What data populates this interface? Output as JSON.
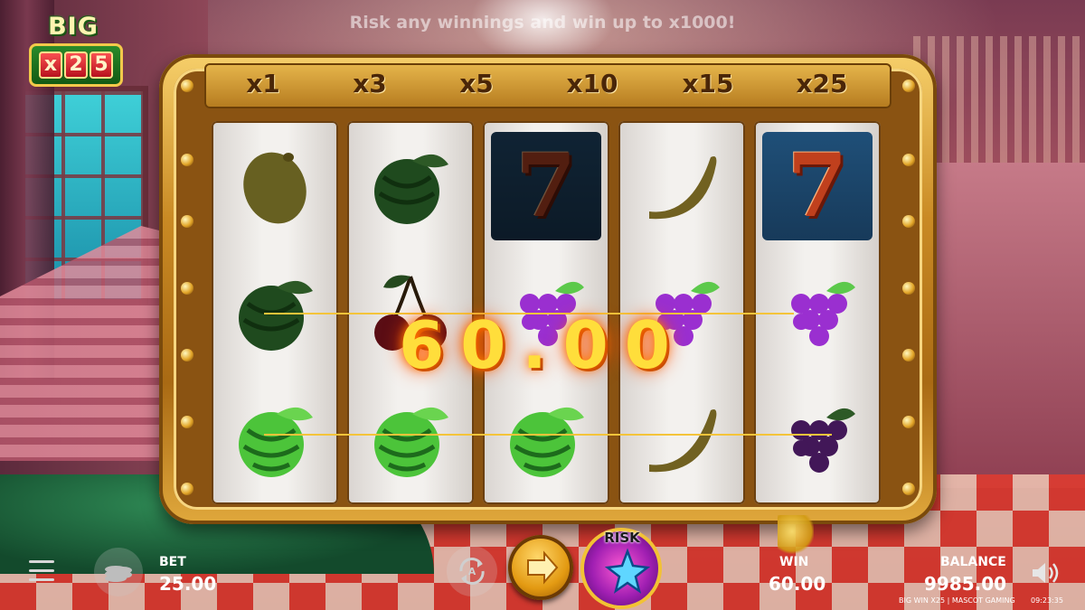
{
  "promo_text": "Risk any winnings and win up to x1000!",
  "logo": {
    "line1": "BIG WIN",
    "digits": [
      "x",
      "2",
      "5"
    ]
  },
  "multipliers": [
    "x1",
    "x3",
    "x5",
    "x10",
    "x15",
    "x25"
  ],
  "reels": [
    [
      "lemon",
      "watermelon",
      "watermelon"
    ],
    [
      "watermelon",
      "cherry",
      "watermelon"
    ],
    [
      "seven",
      "grapes",
      "watermelon"
    ],
    [
      "banana",
      "grapes",
      "banana"
    ],
    [
      "seven",
      "grapes",
      "grapes"
    ]
  ],
  "seven_glyph": "7",
  "win_display": "60.00",
  "bet": {
    "label": "BET",
    "value": "25.00"
  },
  "win": {
    "label": "WIN",
    "value": "60.00"
  },
  "balance": {
    "label": "BALANCE",
    "value": "9985.00"
  },
  "risk_label": "RISK",
  "footer": {
    "game": "BIG WIN X25 | MASCOT GAMING",
    "clock": "09:23:35"
  },
  "icons": {
    "menu": "menu-icon",
    "coins": "coins-stack-icon",
    "autoplay": "autoplay-icon",
    "spin": "arrow-right-icon",
    "risk": "star-icon",
    "sound": "speaker-icon"
  },
  "colors": {
    "frame_gold": "#c98a24",
    "win_glow": "#ff7b00",
    "win_text": "#ffde3b",
    "seven_bg": "#1f4f78"
  }
}
